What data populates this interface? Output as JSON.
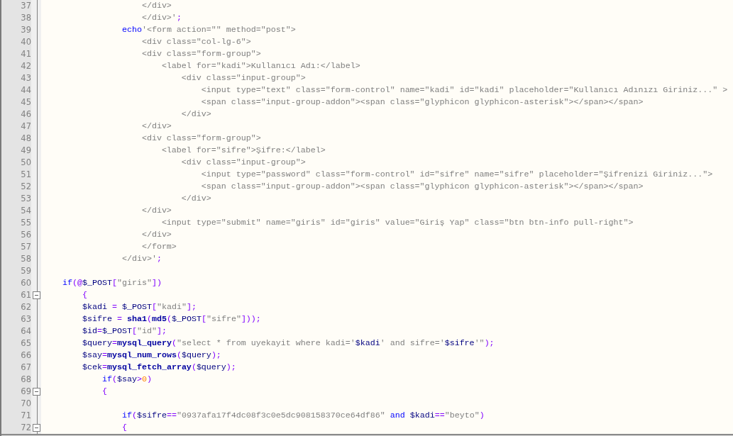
{
  "editor": {
    "lines": [
      {
        "number": "37",
        "fold": false,
        "tokens": [
          {
            "kind": "text",
            "text": "                    </div>"
          }
        ]
      },
      {
        "number": "38",
        "fold": false,
        "tokens": [
          {
            "kind": "text",
            "text": "                    </div>'"
          },
          {
            "kind": "operator",
            "text": ";"
          }
        ]
      },
      {
        "number": "39",
        "fold": false,
        "tokens": [
          {
            "kind": "keyword",
            "text": "                echo"
          },
          {
            "kind": "text",
            "text": "'<form action=\"\" method=\"post\">"
          }
        ]
      },
      {
        "number": "40",
        "fold": false,
        "tokens": [
          {
            "kind": "text",
            "text": "                    <div class=\"col-lg-6\">"
          }
        ]
      },
      {
        "number": "41",
        "fold": false,
        "tokens": [
          {
            "kind": "text",
            "text": "                    <div class=\"form-group\">"
          }
        ]
      },
      {
        "number": "42",
        "fold": false,
        "tokens": [
          {
            "kind": "text",
            "text": "                        <label for=\"kadi\">Kullanıcı Adı:</label>"
          }
        ]
      },
      {
        "number": "43",
        "fold": false,
        "tokens": [
          {
            "kind": "text",
            "text": "                            <div class=\"input-group\">"
          }
        ]
      },
      {
        "number": "44",
        "fold": false,
        "tokens": [
          {
            "kind": "text",
            "text": "                                <input type=\"text\" class=\"form-control\" name=\"kadi\" id=\"kadi\" placeholder=\"Kullanıcı Adınızı Giriniz...\" >"
          }
        ]
      },
      {
        "number": "45",
        "fold": false,
        "tokens": [
          {
            "kind": "text",
            "text": "                                <span class=\"input-group-addon\"><span class=\"glyphicon glyphicon-asterisk\"></span></span>"
          }
        ]
      },
      {
        "number": "46",
        "fold": false,
        "tokens": [
          {
            "kind": "text",
            "text": "                            </div>"
          }
        ]
      },
      {
        "number": "47",
        "fold": false,
        "tokens": [
          {
            "kind": "text",
            "text": "                    </div>"
          }
        ]
      },
      {
        "number": "48",
        "fold": false,
        "tokens": [
          {
            "kind": "text",
            "text": "                    <div class=\"form-group\">"
          }
        ]
      },
      {
        "number": "49",
        "fold": false,
        "tokens": [
          {
            "kind": "text",
            "text": "                        <label for=\"sifre\">Şifre:</label>"
          }
        ]
      },
      {
        "number": "50",
        "fold": false,
        "tokens": [
          {
            "kind": "text",
            "text": "                            <div class=\"input-group\">"
          }
        ]
      },
      {
        "number": "51",
        "fold": false,
        "tokens": [
          {
            "kind": "text",
            "text": "                                <input type=\"password\" class=\"form-control\" id=\"sifre\" name=\"sifre\" placeholder=\"Şifrenizi Giriniz...\">"
          }
        ]
      },
      {
        "number": "52",
        "fold": false,
        "tokens": [
          {
            "kind": "text",
            "text": "                                <span class=\"input-group-addon\"><span class=\"glyphicon glyphicon-asterisk\"></span></span>"
          }
        ]
      },
      {
        "number": "53",
        "fold": false,
        "tokens": [
          {
            "kind": "text",
            "text": "                            </div>"
          }
        ]
      },
      {
        "number": "54",
        "fold": false,
        "tokens": [
          {
            "kind": "text",
            "text": "                    </div>"
          }
        ]
      },
      {
        "number": "55",
        "fold": false,
        "tokens": [
          {
            "kind": "text",
            "text": "                        <input type=\"submit\" name=\"giris\" id=\"giris\" value=\"Giriş Yap\" class=\"btn btn-info pull-right\">"
          }
        ]
      },
      {
        "number": "56",
        "fold": false,
        "tokens": [
          {
            "kind": "text",
            "text": "                    </div>"
          }
        ]
      },
      {
        "number": "57",
        "fold": false,
        "tokens": [
          {
            "kind": "text",
            "text": "                    </form>"
          }
        ]
      },
      {
        "number": "58",
        "fold": false,
        "tokens": [
          {
            "kind": "text",
            "text": "                </div>'"
          },
          {
            "kind": "operator",
            "text": ";"
          }
        ]
      },
      {
        "number": "59",
        "fold": false
      },
      {
        "number": "60",
        "fold": false,
        "tokens": [
          {
            "kind": "keyword",
            "text": "    if"
          },
          {
            "kind": "operator",
            "text": "(@"
          },
          {
            "kind": "variable",
            "text": "$_POST"
          },
          {
            "kind": "operator",
            "text": "["
          },
          {
            "kind": "text",
            "text": "\"giris\""
          },
          {
            "kind": "operator",
            "text": "])"
          }
        ]
      },
      {
        "number": "61",
        "fold": true,
        "tokens": [
          {
            "kind": "operator",
            "text": "        {"
          }
        ]
      },
      {
        "number": "62",
        "fold": false,
        "tokens": [
          {
            "kind": "variable",
            "text": "        $kadi"
          },
          {
            "kind": "operator",
            "text": " = "
          },
          {
            "kind": "variable",
            "text": "$_POST"
          },
          {
            "kind": "operator",
            "text": "["
          },
          {
            "kind": "text",
            "text": "\"kadi\""
          },
          {
            "kind": "operator",
            "text": "];"
          }
        ]
      },
      {
        "number": "63",
        "fold": false,
        "tokens": [
          {
            "kind": "variable",
            "text": "        $sifre"
          },
          {
            "kind": "operator",
            "text": " = "
          },
          {
            "kind": "function",
            "text": "sha1"
          },
          {
            "kind": "operator",
            "text": "("
          },
          {
            "kind": "function",
            "text": "md5"
          },
          {
            "kind": "operator",
            "text": "("
          },
          {
            "kind": "variable",
            "text": "$_POST"
          },
          {
            "kind": "operator",
            "text": "["
          },
          {
            "kind": "text",
            "text": "\"sifre\""
          },
          {
            "kind": "operator",
            "text": "]));"
          }
        ]
      },
      {
        "number": "64",
        "fold": false,
        "tokens": [
          {
            "kind": "variable",
            "text": "        $id"
          },
          {
            "kind": "operator",
            "text": "="
          },
          {
            "kind": "variable",
            "text": "$_POST"
          },
          {
            "kind": "operator",
            "text": "["
          },
          {
            "kind": "text",
            "text": "\"id\""
          },
          {
            "kind": "operator",
            "text": "];"
          }
        ]
      },
      {
        "number": "65",
        "fold": false,
        "tokens": [
          {
            "kind": "variable",
            "text": "        $query"
          },
          {
            "kind": "operator",
            "text": "="
          },
          {
            "kind": "function",
            "text": "mysql_query"
          },
          {
            "kind": "operator",
            "text": "("
          },
          {
            "kind": "text",
            "text": "\"select * from uyekayit where kadi='"
          },
          {
            "kind": "variable",
            "text": "$kadi"
          },
          {
            "kind": "text",
            "text": "' and sifre='"
          },
          {
            "kind": "variable",
            "text": "$sifre"
          },
          {
            "kind": "text",
            "text": "'\""
          },
          {
            "kind": "operator",
            "text": ");"
          }
        ]
      },
      {
        "number": "66",
        "fold": false,
        "tokens": [
          {
            "kind": "variable",
            "text": "        $say"
          },
          {
            "kind": "operator",
            "text": "="
          },
          {
            "kind": "function",
            "text": "mysql_num_rows"
          },
          {
            "kind": "operator",
            "text": "("
          },
          {
            "kind": "variable",
            "text": "$query"
          },
          {
            "kind": "operator",
            "text": ");"
          }
        ]
      },
      {
        "number": "67",
        "fold": false,
        "tokens": [
          {
            "kind": "variable",
            "text": "        $cek"
          },
          {
            "kind": "operator",
            "text": "="
          },
          {
            "kind": "function",
            "text": "mysql_fetch_array"
          },
          {
            "kind": "operator",
            "text": "("
          },
          {
            "kind": "variable",
            "text": "$query"
          },
          {
            "kind": "operator",
            "text": ");"
          }
        ]
      },
      {
        "number": "68",
        "fold": false,
        "tokens": [
          {
            "kind": "keyword",
            "text": "            if"
          },
          {
            "kind": "operator",
            "text": "("
          },
          {
            "kind": "variable",
            "text": "$say"
          },
          {
            "kind": "operator",
            "text": ">"
          },
          {
            "kind": "number",
            "text": "0"
          },
          {
            "kind": "operator",
            "text": ")"
          }
        ]
      },
      {
        "number": "69",
        "fold": true,
        "tokens": [
          {
            "kind": "operator",
            "text": "            {"
          }
        ]
      },
      {
        "number": "70",
        "fold": false
      },
      {
        "number": "71",
        "fold": false,
        "tokens": [
          {
            "kind": "keyword",
            "text": "                if"
          },
          {
            "kind": "operator",
            "text": "("
          },
          {
            "kind": "variable",
            "text": "$sifre"
          },
          {
            "kind": "operator",
            "text": "=="
          },
          {
            "kind": "text",
            "text": "\"0937afa17f4dc08f3c0e5dc908158370ce64df86\""
          },
          {
            "kind": "keyword",
            "text": " and "
          },
          {
            "kind": "variable",
            "text": "$kadi"
          },
          {
            "kind": "operator",
            "text": "=="
          },
          {
            "kind": "text",
            "text": "\"beyto\""
          },
          {
            "kind": "operator",
            "text": ")"
          }
        ]
      },
      {
        "number": "72",
        "fold": true,
        "tokens": [
          {
            "kind": "operator",
            "text": "                {"
          }
        ]
      }
    ]
  }
}
